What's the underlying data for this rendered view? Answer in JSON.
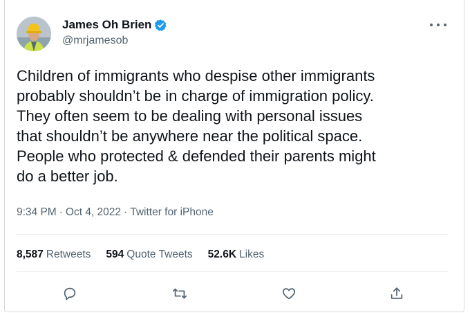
{
  "author": {
    "display_name": "James Oh Brien",
    "handle": "@mrjamesob",
    "avatar_icon": "person-in-hardhat-avatar",
    "verified_icon": "verified-badge-icon"
  },
  "tweet": {
    "lines": [
      "Children of immigrants who despise other immigrants",
      "probably shouldn’t be in charge of immigration policy.",
      "They often seem to be dealing with personal issues",
      "that shouldn’t be anywhere near the political space.",
      "People who protected & defended their parents might",
      "do a better job."
    ]
  },
  "meta": {
    "time": "9:34 PM",
    "date": "Oct 4, 2022",
    "source": "Twitter for iPhone",
    "separator": "·"
  },
  "stats": {
    "retweets": {
      "count": "8,587",
      "label": "Retweets"
    },
    "quotes": {
      "count": "594",
      "label": "Quote Tweets"
    },
    "likes": {
      "count": "52.6K",
      "label": "Likes"
    }
  },
  "colors": {
    "text": "#0f1419",
    "secondary": "#536471",
    "verified": "#1d9bf0",
    "divider": "#e6ecf0"
  }
}
